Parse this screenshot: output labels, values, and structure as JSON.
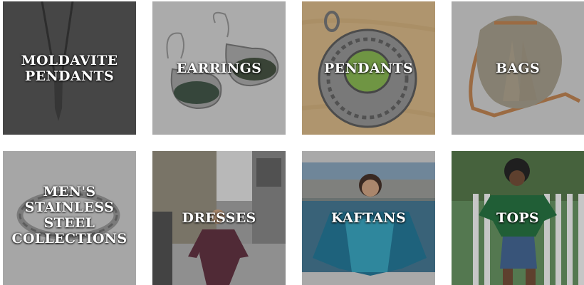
{
  "tiles": [
    {
      "label": "MOLDAVITE PENDANTS"
    },
    {
      "label": "EARRINGS"
    },
    {
      "label": "PENDANTS"
    },
    {
      "label": "BAGS"
    },
    {
      "label": "MEN'S STAINLESS STEEL COLLECTIONS"
    },
    {
      "label": "DRESSES"
    },
    {
      "label": "KAFTANS"
    },
    {
      "label": "TOPS"
    }
  ],
  "colors": {
    "label_text": "#ffffff",
    "gray_bg": "#c4c4c4",
    "dark_bg": "#4a4a4a",
    "wood_bg": "#cdae7e"
  }
}
